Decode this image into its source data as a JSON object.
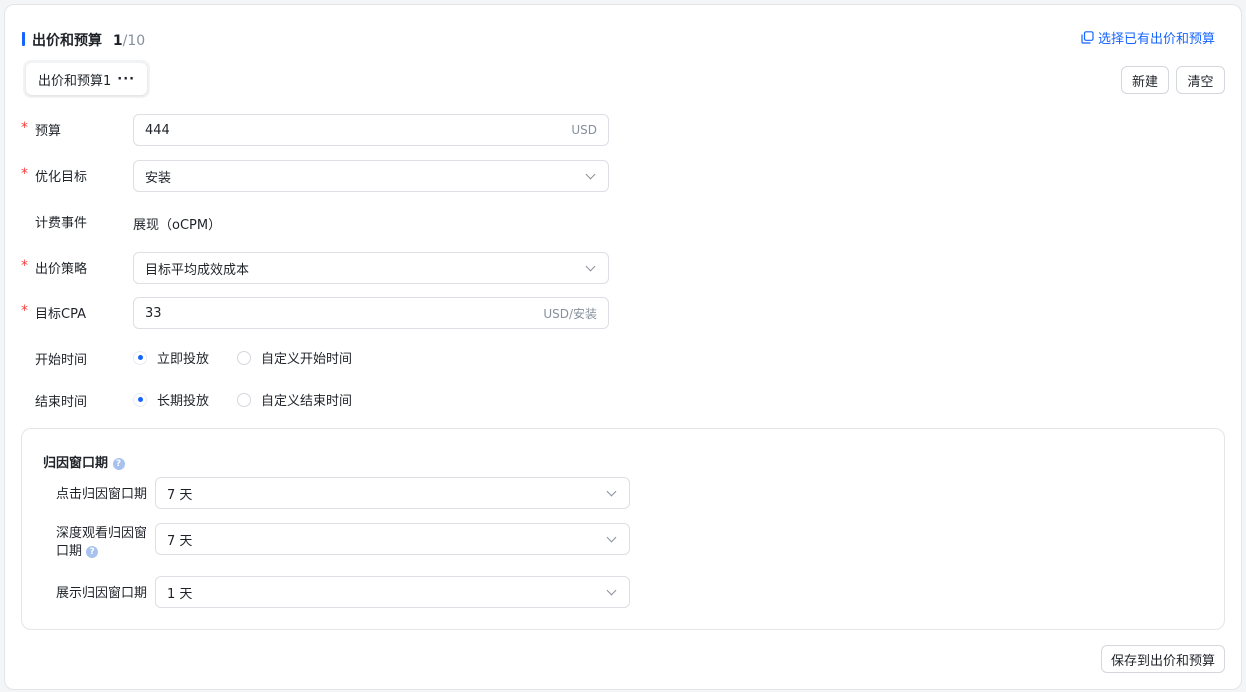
{
  "section": {
    "title": "出价和预算",
    "count": "1",
    "total": "/10",
    "select_existing": "选择已有出价和预算"
  },
  "tabs": [
    {
      "label": "出价和预算1",
      "more": "···"
    }
  ],
  "actions": {
    "new_label": "新建",
    "clear_label": "清空"
  },
  "form": {
    "budget": {
      "label": "预算",
      "value": "444",
      "unit": "USD"
    },
    "optimization_goal": {
      "label": "优化目标",
      "value": "安装"
    },
    "billing_event": {
      "label": "计费事件",
      "value": "展现（oCPM）"
    },
    "bid_strategy": {
      "label": "出价策略",
      "value": "目标平均成效成本"
    },
    "target_cpa": {
      "label": "目标CPA",
      "value": "33",
      "unit": "USD/安装"
    },
    "start_time": {
      "label": "开始时间",
      "options": [
        "立即投放",
        "自定义开始时间"
      ],
      "selected": "立即投放"
    },
    "end_time": {
      "label": "结束时间",
      "options": [
        "长期投放",
        "自定义结束时间"
      ],
      "selected": "长期投放"
    }
  },
  "attribution": {
    "title": "归因窗口期",
    "click": {
      "label": "点击归因窗口期",
      "value": "7 天"
    },
    "deep_view": {
      "label_line1": "深度观看归因窗",
      "label_line2": "口期",
      "value": "7 天"
    },
    "impression": {
      "label": "展示归因窗口期",
      "value": "1 天"
    }
  },
  "footer": {
    "save_label": "保存到出价和预算"
  },
  "colors": {
    "accent": "#1664ff",
    "required": "#f53f3f"
  }
}
